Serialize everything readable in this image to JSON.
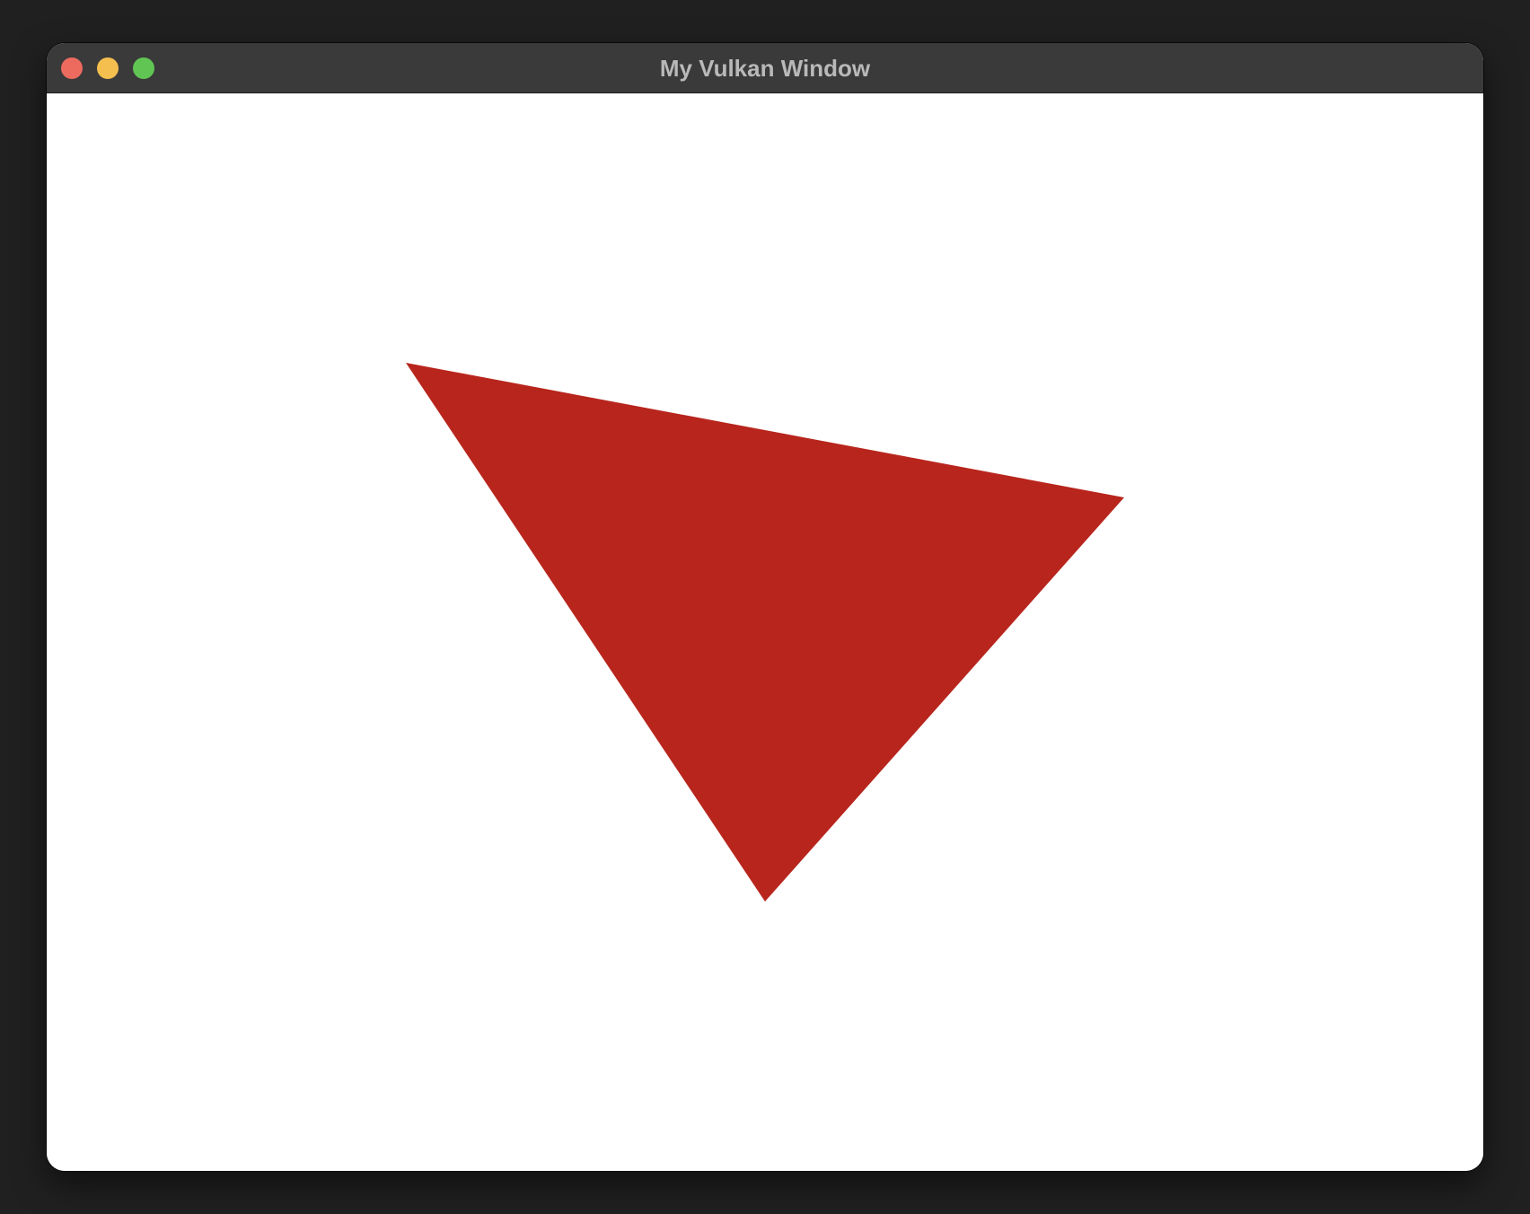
{
  "window": {
    "title": "My Vulkan Window",
    "controls": [
      "close",
      "minimize",
      "zoom"
    ]
  },
  "scene": {
    "background_color": "#ffffff",
    "shape": "triangle",
    "fill_color": "#b8251c"
  },
  "colors": {
    "titlebar": "#3a3a3a",
    "close": "#ec6a5e",
    "minimize": "#f4bf4f",
    "zoom": "#61c554"
  }
}
